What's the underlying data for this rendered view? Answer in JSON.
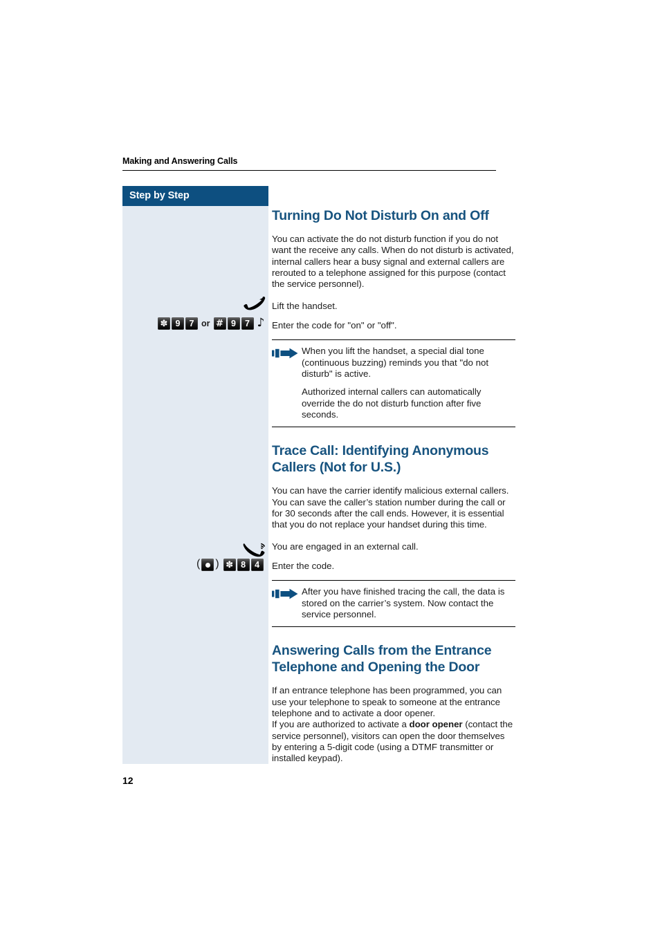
{
  "document": {
    "running_header": "Making and Answering Calls",
    "page_number": "12",
    "sidebar_label": "Step by Step",
    "colors": {
      "brand_blue": "#0d4f80",
      "heading_blue": "#17537f",
      "sidebar_bg": "#e3eaf2",
      "rule": "#000000"
    }
  },
  "sections": [
    {
      "title": "Turning Do Not Disturb On and Off",
      "intro": "You can activate the do not disturb function if you do not want the receive any calls. When do not disturb is activated, internal callers hear a busy signal and external callers are rerouted to a telephone assigned for this purpose (contact the service personnel).",
      "steps": [
        {
          "text": "Lift the handset.",
          "icon": "handset-lift-icon"
        },
        {
          "text": "Enter the code for \"on\" or \"off\".",
          "keys": [
            "star",
            "9",
            "7",
            "or",
            "hash",
            "9",
            "7"
          ],
          "tone": "♪"
        }
      ],
      "note": {
        "icon": "note-arrow-icon",
        "paragraphs": [
          "When you lift the handset, a special dial tone (continuous buzzing) reminds you that \"do not disturb\" is active.",
          "Authorized internal callers can automatically override the do not disturb function after five seconds."
        ]
      }
    },
    {
      "title": "Trace Call: Identifying Anonymous Callers (Not for U.S.)",
      "intro": "You can have the carrier identify malicious external callers. You can save the caller’s station number during the call or for 30 seconds after the call ends. However, it is essential that you do not replace your handset during this time.",
      "steps": [
        {
          "text": "You are engaged in an external call.",
          "icon": "handset-in-use-icon"
        },
        {
          "text": "Enter the code.",
          "keys": [
            "paren-open",
            "dot",
            "paren-close",
            "star",
            "8",
            "4"
          ]
        }
      ],
      "note": {
        "icon": "note-arrow-icon",
        "paragraphs": [
          "After you have finished tracing the call, the data is stored on the carrier’s system. Now contact the service personnel."
        ]
      }
    },
    {
      "title": "Answering Calls from the Entrance Telephone and Opening the Door",
      "body_parts": [
        {
          "text": "If an entrance telephone has been programmed, you can use your telephone to speak to someone at the entrance telephone and to activate a door opener.",
          "bold": false
        },
        {
          "text": "If you are authorized to activate a ",
          "bold": false
        },
        {
          "text": "door opener",
          "bold": true
        },
        {
          "text": " (contact the service personnel), visitors can open the door themselves by entering a 5-digit code (using a DTMF transmitter or installed keypad).",
          "bold": false
        }
      ]
    }
  ],
  "key_glyphs": {
    "star": "✽",
    "hash": "#",
    "or_label": "or",
    "paren_open": "(",
    "paren_close": ")"
  }
}
